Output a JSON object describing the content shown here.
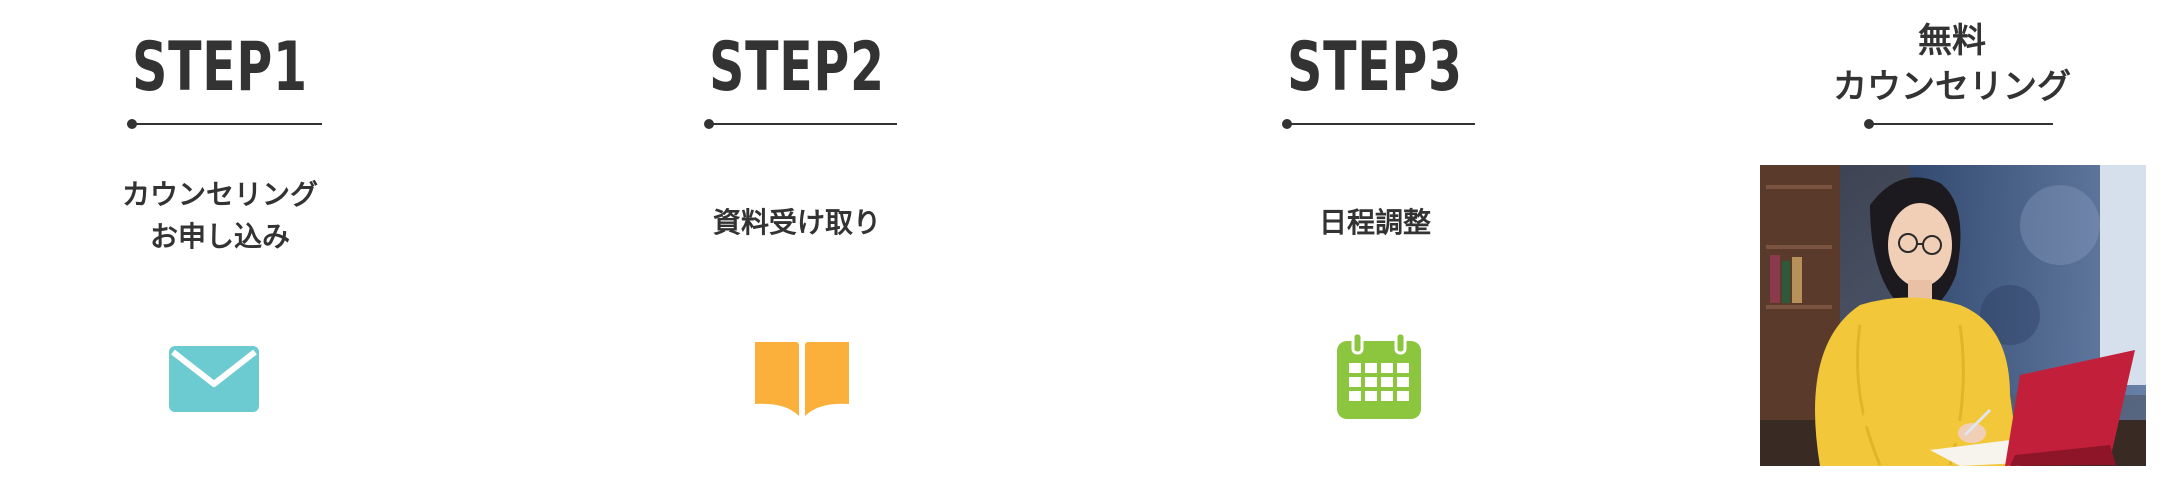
{
  "steps": [
    {
      "title": "STEP1",
      "description": "カウンセリング\nお申し込み",
      "icon": "envelope-icon",
      "icon_color": "#6ccbd1"
    },
    {
      "title": "STEP2",
      "description": "資料受け取り",
      "icon": "open-book-icon",
      "icon_color": "#fbb03b"
    },
    {
      "title": "STEP3",
      "description": "日程調整",
      "icon": "calendar-icon",
      "icon_color": "#8cc63f"
    }
  ],
  "free_counseling": {
    "title_line1": "無料",
    "title_line2": "カウンセリング"
  },
  "colors": {
    "text": "#333333",
    "divider": "#333333",
    "background": "#ffffff"
  }
}
